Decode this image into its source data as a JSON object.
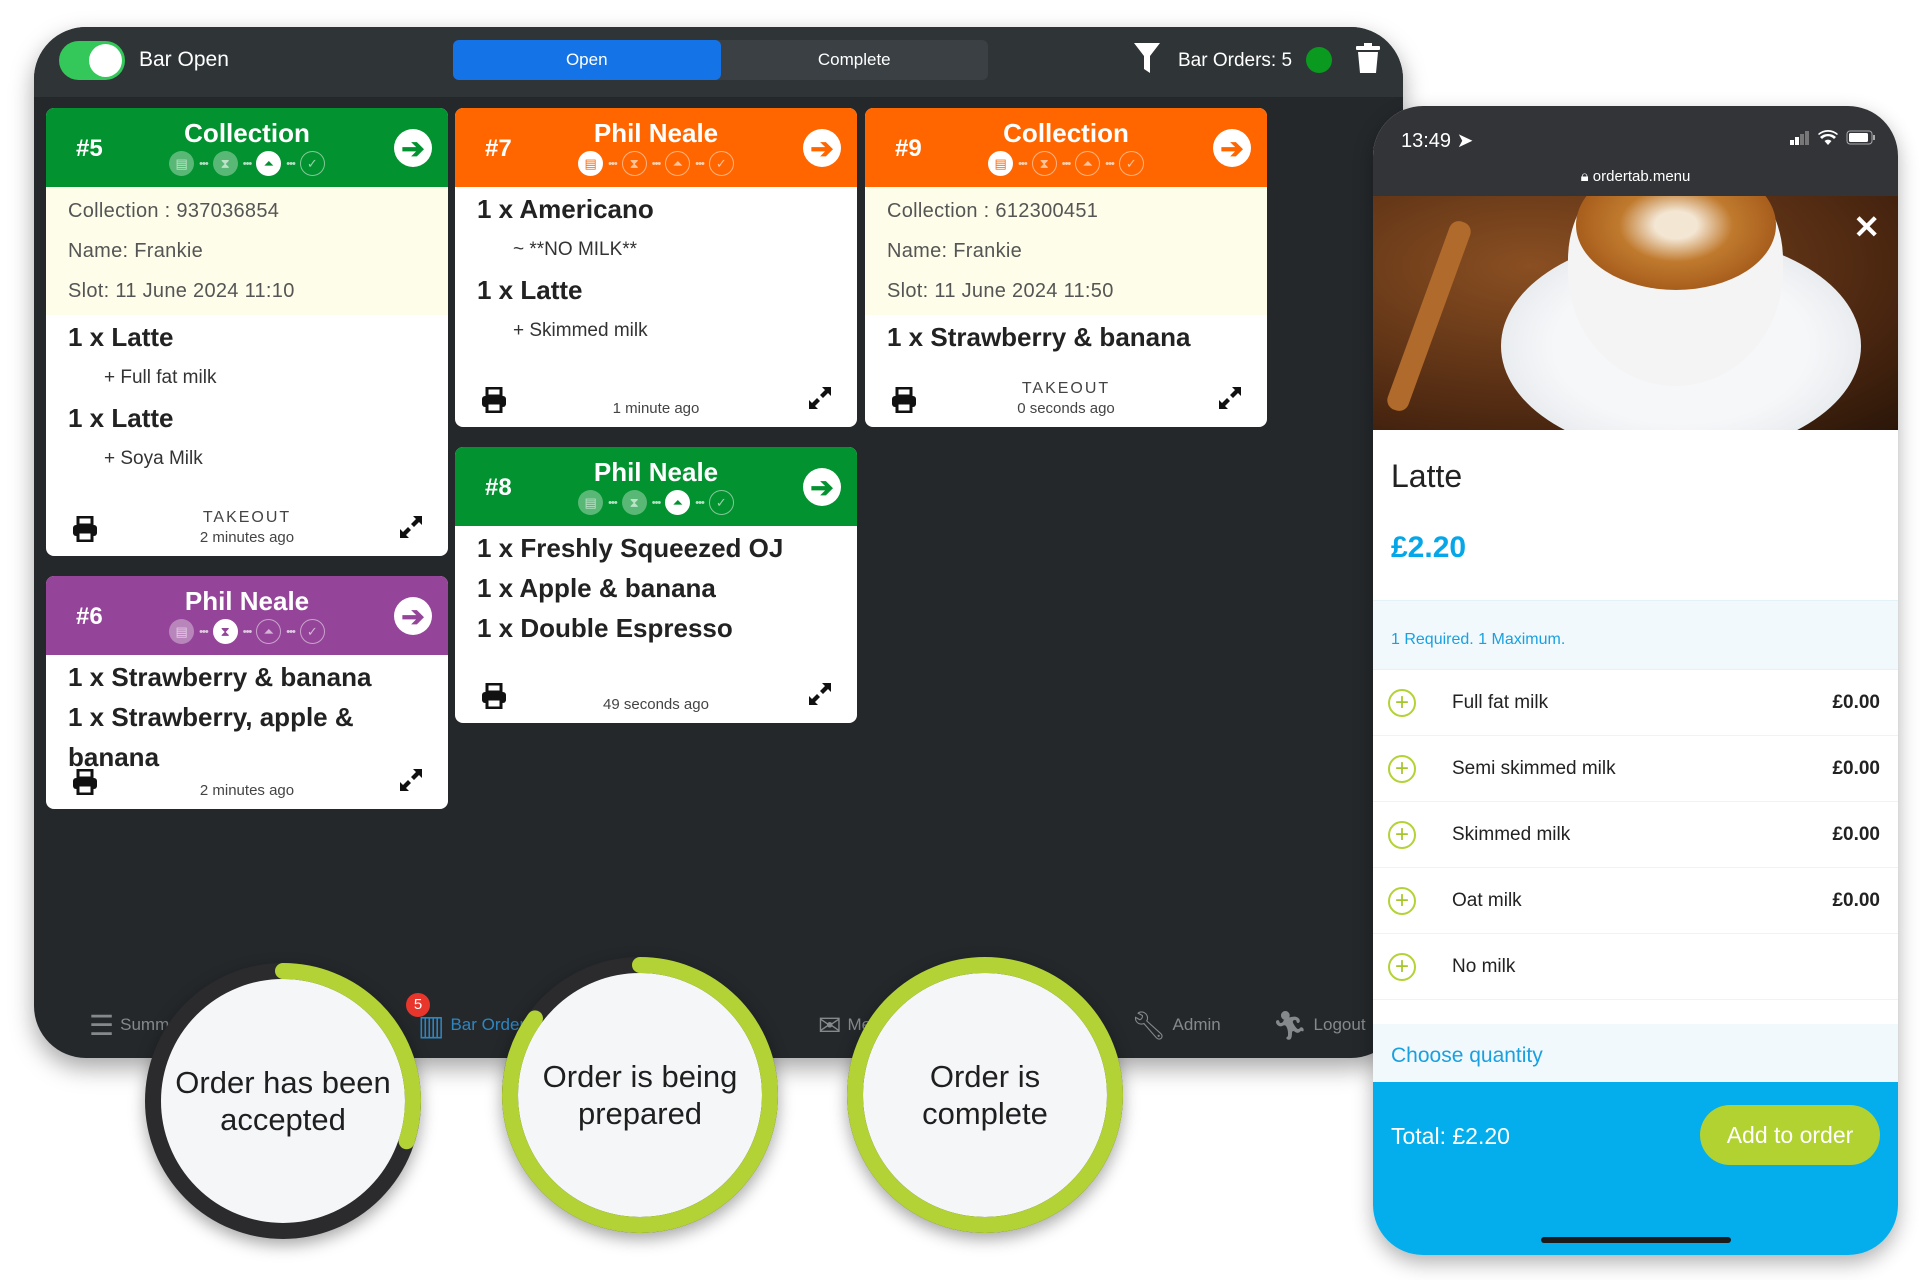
{
  "header": {
    "bar_toggle_label": "Bar Open",
    "bar_open": true,
    "tabs": [
      {
        "label": "Open",
        "active": true
      },
      {
        "label": "Complete",
        "active": false
      }
    ],
    "bar_orders": "Bar Orders: 5",
    "status_color": "#0a9a1f"
  },
  "cards": [
    {
      "number": "#5",
      "title": "Collection",
      "color": "#02922f",
      "step": 3,
      "info": [
        "Collection : 937036854",
        "Name: Frankie",
        "Slot: 11 June 2024 11:10"
      ],
      "items": [
        {
          "text": "1 x Latte",
          "mods": [
            "+ Full fat milk"
          ]
        },
        {
          "text": "1 x Latte",
          "mods": [
            "+ Soya Milk"
          ]
        }
      ],
      "order_type": "TAKEOUT",
      "time": "2 minutes ago"
    },
    {
      "number": "#7",
      "title": "Phil Neale",
      "color": "#ff6600",
      "step": 1,
      "info": [],
      "items": [
        {
          "text": "1 x Americano",
          "mods": [
            "~ **NO MILK**"
          ]
        },
        {
          "text": "1 x Latte",
          "mods": [
            "+ Skimmed milk"
          ]
        }
      ],
      "order_type": "",
      "time": "1 minute ago"
    },
    {
      "number": "#9",
      "title": "Collection",
      "color": "#ff6600",
      "step": 1,
      "info": [
        "Collection : 612300451",
        "Name: Frankie",
        "Slot: 11 June 2024 11:50"
      ],
      "items": [
        {
          "text": "1 x Strawberry & banana",
          "mods": []
        }
      ],
      "order_type": "TAKEOUT",
      "time": "0 seconds ago"
    },
    {
      "number": "#6",
      "title": "Phil Neale",
      "color": "#944599",
      "step": 2,
      "info": [],
      "items": [
        {
          "text": "1 x Strawberry & banana",
          "mods": []
        },
        {
          "text": "1 x Strawberry, apple & banana",
          "mods": []
        }
      ],
      "order_type": "",
      "time": "2 minutes ago"
    },
    {
      "number": "#8",
      "title": "Phil Neale",
      "color": "#02922f",
      "step": 3,
      "info": [],
      "items": [
        {
          "text": "1 x Freshly Squeezed OJ",
          "mods": []
        },
        {
          "text": "1 x Apple & banana",
          "mods": []
        },
        {
          "text": "1 x Double Espresso",
          "mods": []
        }
      ],
      "order_type": "",
      "time": "49 seconds ago"
    }
  ],
  "nav": [
    {
      "label": "Summary",
      "icon": "notepad-icon",
      "active": false
    },
    {
      "label": "Bar Orders",
      "icon": "bar-orders-icon",
      "active": true,
      "badge": "5"
    },
    {
      "label": "Messages",
      "icon": "envelope-icon",
      "active": false
    },
    {
      "label": "Admin",
      "icon": "wrench-icon",
      "active": false
    },
    {
      "label": "Logout",
      "icon": "running-person-icon",
      "active": false
    }
  ],
  "status_circles": [
    {
      "text": "Order has been accepted",
      "progress": 0.3
    },
    {
      "text": "Order is being prepared",
      "progress": 0.85
    },
    {
      "text": "Order is complete",
      "progress": 1.0
    }
  ],
  "phone": {
    "time": "13:49",
    "url": "ordertab.menu",
    "product": "Latte",
    "price": "£2.20",
    "requirement": "1 Required. 1 Maximum.",
    "options": [
      {
        "name": "Full fat milk",
        "price": "£0.00"
      },
      {
        "name": "Semi skimmed milk",
        "price": "£0.00"
      },
      {
        "name": "Skimmed milk",
        "price": "£0.00"
      },
      {
        "name": "Oat milk",
        "price": "£0.00"
      },
      {
        "name": "No milk",
        "price": ""
      }
    ],
    "choose_quantity": "Choose quantity",
    "total": "Total: £2.20",
    "add_button": "Add to order",
    "accent": "#04adeb",
    "button_color": "#b2d232"
  }
}
